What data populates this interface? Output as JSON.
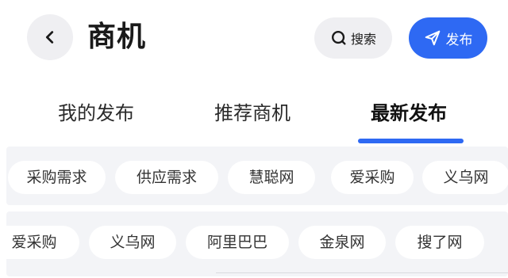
{
  "header": {
    "title": "商机",
    "search_label": "搜索",
    "publish_label": "发布"
  },
  "tabs": [
    {
      "label": "我的发布",
      "active": false
    },
    {
      "label": "推荐商机",
      "active": false
    },
    {
      "label": "最新发布",
      "active": true
    }
  ],
  "chips_row1": [
    "采购需求",
    "供应需求",
    "慧聪网",
    "爱采购",
    "义乌网"
  ],
  "chips_row2": [
    "爱采购",
    "义乌网",
    "阿里巴巴",
    "金泉网",
    "搜了网"
  ],
  "colors": {
    "accent": "#2e69f3",
    "chip_bg": "#ffffff",
    "panel_bg": "#f3f4f7",
    "button_gray": "#efeff2"
  },
  "icons": {
    "back": "chevron-left-icon",
    "search": "search-icon",
    "publish": "send-icon"
  }
}
